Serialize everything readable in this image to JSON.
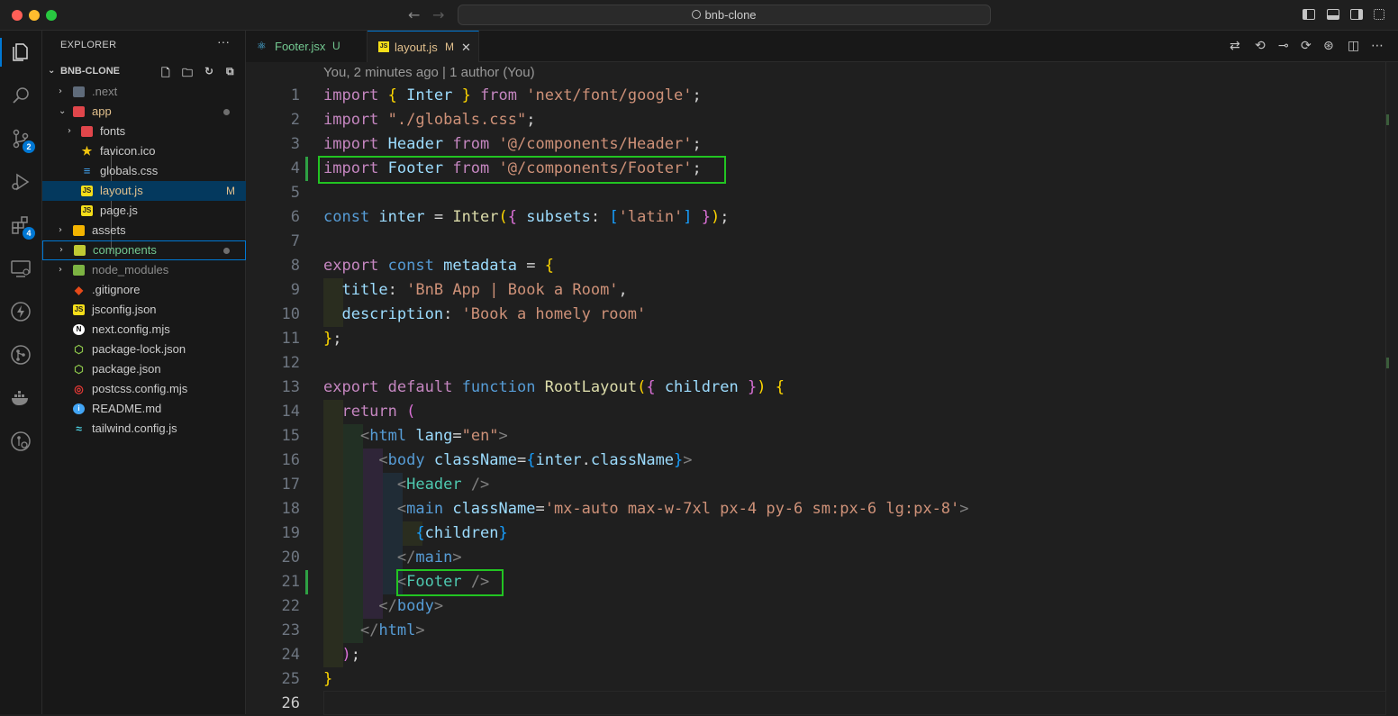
{
  "window": {
    "title": "bnb-clone"
  },
  "explorer": {
    "title": "EXPLORER",
    "more": "···",
    "project": "BNB-CLONE",
    "items": [
      {
        "label": ".next",
        "type": "folder-closed"
      },
      {
        "label": "app",
        "type": "folder-open"
      },
      {
        "label": "fonts",
        "type": "folder-closed"
      },
      {
        "label": "favicon.ico",
        "type": "file"
      },
      {
        "label": "globals.css",
        "type": "file"
      },
      {
        "label": "layout.js",
        "type": "file",
        "badge": "M"
      },
      {
        "label": "page.js",
        "type": "file"
      },
      {
        "label": "assets",
        "type": "folder-closed"
      },
      {
        "label": "components",
        "type": "folder-closed"
      },
      {
        "label": "node_modules",
        "type": "folder-closed"
      },
      {
        "label": ".gitignore",
        "type": "file"
      },
      {
        "label": "jsconfig.json",
        "type": "file"
      },
      {
        "label": "next.config.mjs",
        "type": "file"
      },
      {
        "label": "package-lock.json",
        "type": "file"
      },
      {
        "label": "package.json",
        "type": "file"
      },
      {
        "label": "postcss.config.mjs",
        "type": "file"
      },
      {
        "label": "README.md",
        "type": "file"
      },
      {
        "label": "tailwind.config.js",
        "type": "file"
      }
    ]
  },
  "activity": {
    "source_control_badge": "2",
    "extensions_badge": "4"
  },
  "tabs": [
    {
      "label": "Footer.jsx",
      "status": "U",
      "active": false
    },
    {
      "label": "layout.js",
      "status": "M",
      "active": true,
      "close": "✕"
    }
  ],
  "editor": {
    "blame": "You, 2 minutes ago | 1 author (You)",
    "line_numbers": [
      "1",
      "2",
      "3",
      "4",
      "5",
      "6",
      "7",
      "8",
      "9",
      "10",
      "11",
      "12",
      "13",
      "14",
      "15",
      "16",
      "17",
      "18",
      "19",
      "20",
      "21",
      "22",
      "23",
      "24",
      "25",
      "26"
    ],
    "tokens": {
      "l1": [
        "import",
        " ",
        "{",
        " Inter ",
        "}",
        " from ",
        "'next/font/google'",
        ";"
      ],
      "l2": [
        "import",
        " ",
        "\"./globals.css\"",
        ";"
      ],
      "l3": [
        "import",
        " Header ",
        "from",
        " ",
        "'@/components/Header'",
        ";"
      ],
      "l4": [
        "import",
        " Footer ",
        "from",
        " ",
        "'@/components/Footer'",
        ";"
      ],
      "l6": [
        "const",
        " inter ",
        "=",
        " Inter",
        "(",
        "{",
        " subsets",
        ": ",
        "[",
        "'latin'",
        "]",
        " ",
        "}",
        ")",
        ";"
      ],
      "l8": [
        "export",
        " ",
        "const",
        " metadata ",
        "=",
        " ",
        "{"
      ],
      "l9": [
        "  title",
        ": ",
        "'BnB App | Book a Room'",
        ","
      ],
      "l10": [
        "  description",
        ": ",
        "'Book a homely room'"
      ],
      "l11": [
        "}",
        ";"
      ],
      "l13": [
        "export",
        " ",
        "default",
        " ",
        "function",
        " ",
        "RootLayout",
        "(",
        "{",
        " children ",
        "}",
        ")",
        " ",
        "{"
      ],
      "l14": [
        "  return",
        " ",
        "("
      ],
      "l15": [
        "    ",
        "<",
        "html",
        " lang",
        "=",
        "\"en\"",
        ">"
      ],
      "l16": [
        "      ",
        "<",
        "body",
        " className",
        "=",
        "{",
        "inter",
        ".",
        "className",
        "}",
        ">"
      ],
      "l17": [
        "        ",
        "<",
        "Header",
        " ",
        "/>"
      ],
      "l18": [
        "        ",
        "<",
        "main",
        " className",
        "=",
        "'mx-auto max-w-7xl px-4 py-6 sm:px-6 lg:px-8'",
        ">"
      ],
      "l19": [
        "          ",
        "{",
        "children",
        "}"
      ],
      "l20": [
        "        ",
        "</",
        "main",
        ">"
      ],
      "l21": [
        "        ",
        "<",
        "Footer",
        " ",
        "/>"
      ],
      "l22": [
        "      ",
        "</",
        "body",
        ">"
      ],
      "l23": [
        "    ",
        "</",
        "html",
        ">"
      ],
      "l24": [
        "  ",
        ")",
        ";"
      ],
      "l25": [
        "}"
      ]
    }
  },
  "colors": {
    "accent": "#0078d4",
    "highlight_box": "#22c422",
    "git_added": "#2ea043",
    "modified": "#e2c08d",
    "untracked": "#73c991"
  }
}
